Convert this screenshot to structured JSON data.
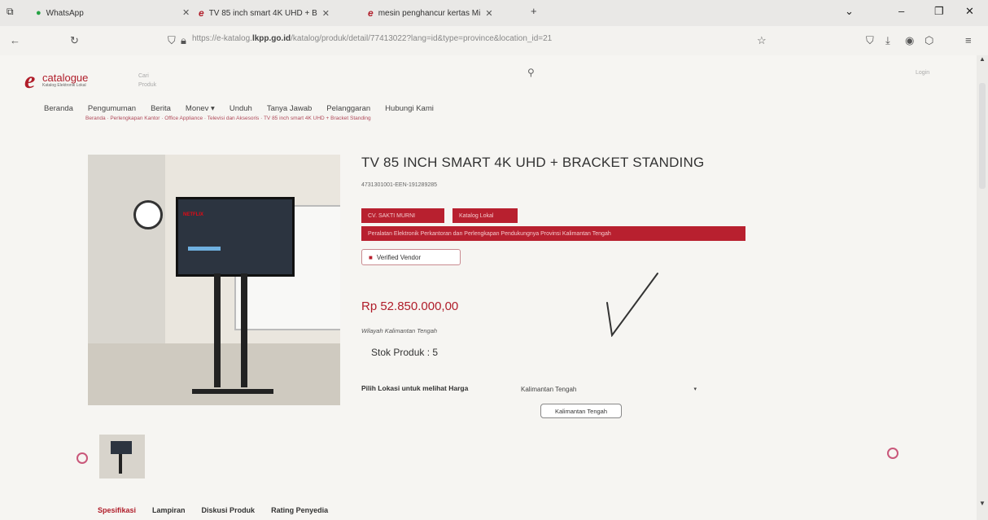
{
  "browser": {
    "tabs": [
      {
        "label": "WhatsApp"
      },
      {
        "label": "TV 85 inch smart 4K UHD + B"
      },
      {
        "label": "mesin penghancur kertas Mi"
      }
    ],
    "new_tab": "+",
    "url_prefix": "https://e-katalog.",
    "url_domain": "lkpp.go.id",
    "url_rest": "/katalog/produk/detail/77413022?lang=id&type=province&location_id=21"
  },
  "header": {
    "logo_text": "catalogue",
    "logo_sub": "Katalog Elektronik Lokal",
    "search_label_1": "Cari",
    "search_label_2": "Produk",
    "login": "Login"
  },
  "menu": [
    "Beranda",
    "Pengumuman",
    "Berita",
    "Monev ▾",
    "Unduh",
    "Tanya Jawab",
    "Pelanggaran",
    "Hubungi Kami"
  ],
  "breadcrumb": "Beranda · Perlengkapan Kantor · Office Appliance · Televisi dan Aksesoris · TV 85 inch smart 4K UHD + Bracket Standing",
  "product": {
    "title": "TV 85 INCH SMART 4K UHD + BRACKET STANDING",
    "code": "4731301001-EEN-191289285",
    "badge_vendor": "CV. SAKTI MURNI",
    "badge_catalog": "Katalog Lokal",
    "badge_region": "Peralatan Elektronik Perkantoran dan Perlengkapan Pendukungnya Provinsi Kalimantan Tengah",
    "verified": "Verified Vendor",
    "price": "Rp 52.850.000,00",
    "region": "Wilayah Kalimantan Tengah",
    "stock": "Stok Produk :  5",
    "location_label": "Pilih Lokasi untuk melihat Harga",
    "location_value": "Kalimantan Tengah",
    "location_button": "Kalimantan Tengah",
    "tv_brand": "NETFLIX"
  },
  "detail_tabs": [
    "Spesifikasi",
    "Lampiran",
    "Diskusi Produk",
    "Rating Penyedia"
  ],
  "colors": {
    "accent": "#b01d2a",
    "badge": "#b8202f"
  }
}
